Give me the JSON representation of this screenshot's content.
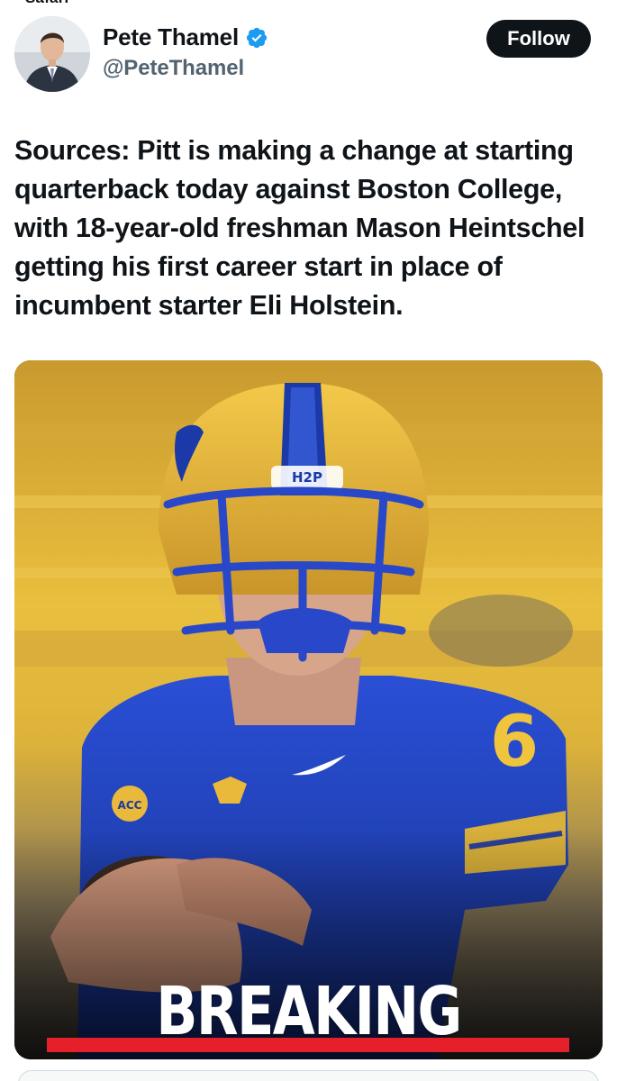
{
  "status": {
    "carrier_text": "Safari"
  },
  "author": {
    "display_name": "Pete Thamel",
    "handle": "@PeteThamel",
    "verified": true,
    "verified_color": "#1d9bf0"
  },
  "actions": {
    "follow_label": "Follow"
  },
  "tweet": {
    "text": "Sources: Pitt is making a change at starting quarterback today against Boston College, with 18-year-old freshman Mason Heintschel getting his first career start in place of incumbent starter Eli Holstein."
  },
  "media": {
    "overlay_title": "BREAKING NEWS",
    "overlay_bar_color": "#e5202a",
    "helmet_sticker": "H2P",
    "jersey_number": "6",
    "conference_patch": "ACC"
  }
}
